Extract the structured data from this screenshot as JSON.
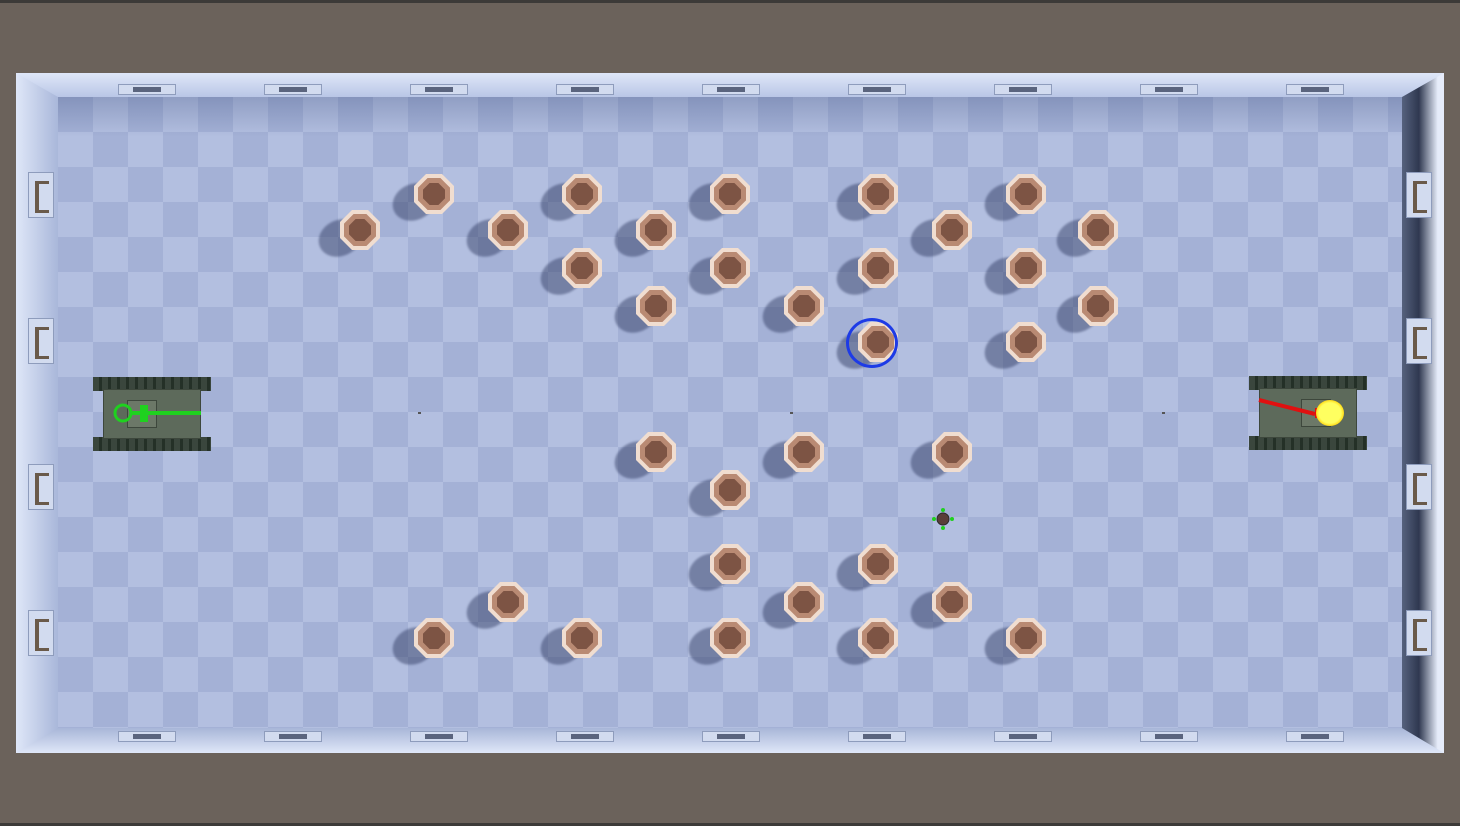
{
  "scene": {
    "background_color": "#6b625b",
    "floor_color_a": "#a4b1d6",
    "floor_color_b": "#b3bfe0",
    "wall_color": "#c4d0ea"
  },
  "player_tank": {
    "team_color": "#1fd11f",
    "hull_color": "#5d6a5b",
    "icon": "green-tank-icon"
  },
  "enemy_tank": {
    "team_color": "#e01010",
    "hull_color": "#5d6a5b",
    "icon": "red-tank-icon",
    "firing": true
  },
  "barrel_object": {
    "icon": "barrel-icon",
    "color": "#b98a73"
  },
  "selection": {
    "icon": "rotate-gizmo-icon",
    "color": "#1d3be6"
  },
  "waypoint": {
    "icon": "move-gizmo-icon",
    "color": "#1fd11f"
  }
}
